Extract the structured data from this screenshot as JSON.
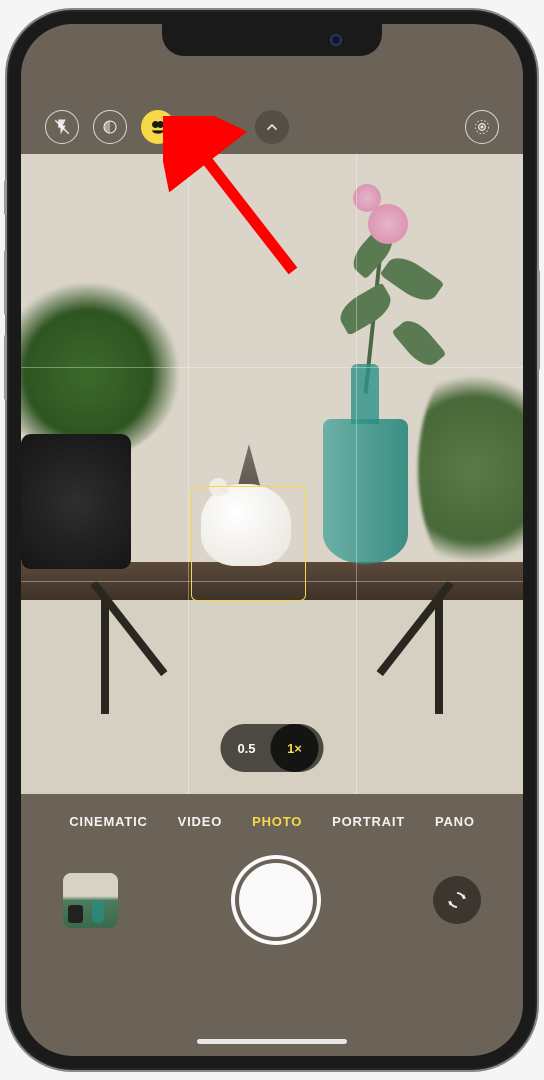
{
  "annotation": {
    "arrow_color": "#ff0000",
    "points_to": "photographic-styles-icon"
  },
  "top_controls": {
    "flash": "flash-off-icon",
    "night": "night-mode-icon",
    "styles": "photographic-styles-icon",
    "styles_active": true,
    "expand": "chevron-up-icon",
    "live": "live-photo-icon"
  },
  "viewfinder": {
    "zoom": {
      "wide_label": "0.5",
      "default_label": "1×",
      "active": "1x"
    },
    "focus_box_color": "#f5d949"
  },
  "modes": {
    "items": [
      "CINEMATIC",
      "VIDEO",
      "PHOTO",
      "PORTRAIT",
      "PANO"
    ],
    "active_index": 2
  },
  "controls": {
    "thumbnail_alt": "last-photo-thumbnail",
    "shutter_alt": "shutter-button",
    "flip_alt": "camera-flip-icon"
  },
  "colors": {
    "accent": "#f5d949",
    "chrome": "#6b6258"
  }
}
